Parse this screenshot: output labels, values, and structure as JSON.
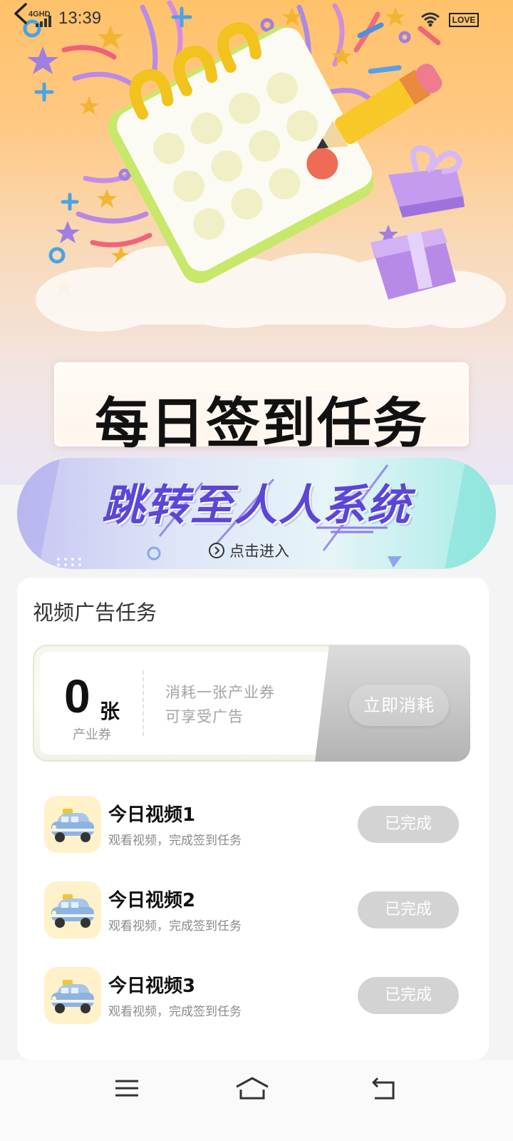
{
  "status_bar": {
    "network": "4GHD",
    "time": "13:39",
    "badge": "LOVE"
  },
  "hero": {
    "title": "每日签到任务"
  },
  "banner": {
    "title": "跳转至人人系统",
    "enter_label": "点击进入"
  },
  "video_tasks": {
    "section_title": "视频广告任务",
    "voucher": {
      "count": "0",
      "unit": "张",
      "label": "产业券",
      "desc_line1": "消耗一张产业券",
      "desc_line2": "可享受广告",
      "button": "立即消耗"
    },
    "items": [
      {
        "title": "今日视频1",
        "subtitle": "观看视频，完成签到任务",
        "button": "已完成"
      },
      {
        "title": "今日视频2",
        "subtitle": "观看视频，完成签到任务",
        "button": "已完成"
      },
      {
        "title": "今日视频3",
        "subtitle": "观看视频，完成签到任务",
        "button": "已完成"
      }
    ]
  },
  "colors": {
    "hero_top": "#ffc26a",
    "banner_accent": "#5b46d6",
    "done_button": "#d3d3d3"
  },
  "icons": [
    "back-icon",
    "signal-icon",
    "wifi-icon",
    "enter-arrow-icon",
    "taxi-icon",
    "menu-icon",
    "home-icon",
    "back-nav-icon"
  ]
}
